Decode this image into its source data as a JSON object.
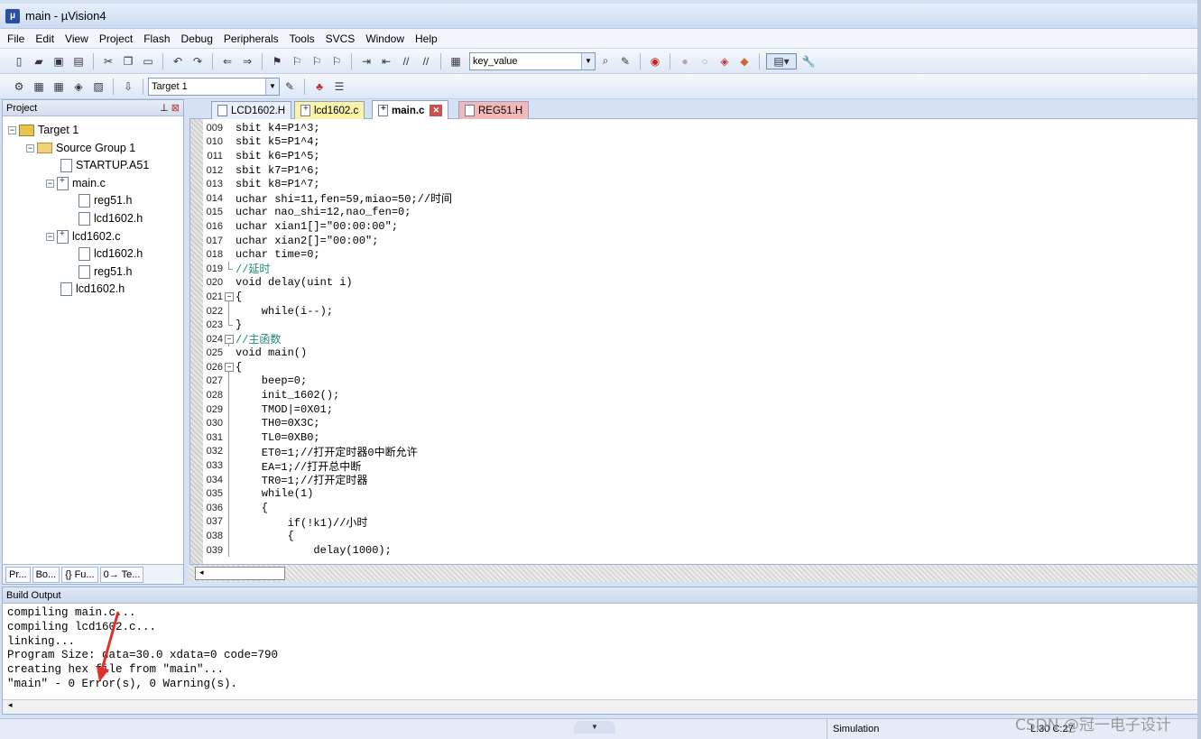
{
  "window": {
    "title": "main  - µVision4"
  },
  "menu": [
    "File",
    "Edit",
    "View",
    "Project",
    "Flash",
    "Debug",
    "Peripherals",
    "Tools",
    "SVCS",
    "Window",
    "Help"
  ],
  "toolbar": {
    "find_combo": "key_value",
    "target_combo": "Target 1"
  },
  "project_panel": {
    "title": "Project",
    "tree": [
      {
        "label": "Target 1",
        "icon": "target-icon"
      },
      {
        "label": "Source Group 1",
        "icon": "folder-icon"
      },
      {
        "label": "STARTUP.A51",
        "icon": "file-icon"
      },
      {
        "label": "main.c",
        "icon": "c-file-icon"
      },
      {
        "label": "reg51.h",
        "icon": "header-file-icon"
      },
      {
        "label": "lcd1602.h",
        "icon": "header-file-icon"
      },
      {
        "label": "lcd1602.c",
        "icon": "c-file-icon"
      },
      {
        "label": "lcd1602.h",
        "icon": "header-file-icon"
      },
      {
        "label": "reg51.h",
        "icon": "header-file-icon"
      },
      {
        "label": "lcd1602.h",
        "icon": "header-file-icon"
      }
    ],
    "tabs": [
      "Pr...",
      "Bo...",
      "{} Fu...",
      "0→ Te..."
    ]
  },
  "editor": {
    "tabs": [
      {
        "label": "LCD1602.H",
        "style": "normal"
      },
      {
        "label": "lcd1602.c",
        "style": "yellow"
      },
      {
        "label": "main.c",
        "style": "active"
      },
      {
        "label": "REG51.H",
        "style": "red"
      }
    ],
    "lines": [
      {
        "n": "009",
        "t": "sbit k4=P1^3;"
      },
      {
        "n": "010",
        "t": "sbit k5=P1^4;"
      },
      {
        "n": "011",
        "t": "sbit k6=P1^5;"
      },
      {
        "n": "012",
        "t": "sbit k7=P1^6;"
      },
      {
        "n": "013",
        "t": "sbit k8=P1^7;"
      },
      {
        "n": "014",
        "t": "uchar shi=11,fen=59,miao=50;//时间"
      },
      {
        "n": "015",
        "t": "uchar nao_shi=12,nao_fen=0;"
      },
      {
        "n": "016",
        "t": "uchar xian1[]=\"00:00:00\";"
      },
      {
        "n": "017",
        "t": "uchar xian2[]=\"00:00\";"
      },
      {
        "n": "018",
        "t": "uchar time=0;"
      },
      {
        "n": "019",
        "t": "//延时"
      },
      {
        "n": "020",
        "t": "void delay(uint i)"
      },
      {
        "n": "021",
        "t": "{"
      },
      {
        "n": "022",
        "t": "    while(i--);"
      },
      {
        "n": "023",
        "t": "}"
      },
      {
        "n": "024",
        "t": "//主函数"
      },
      {
        "n": "025",
        "t": "void main()"
      },
      {
        "n": "026",
        "t": "{"
      },
      {
        "n": "027",
        "t": "    beep=0;"
      },
      {
        "n": "028",
        "t": "    init_1602();"
      },
      {
        "n": "029",
        "t": "    TMOD|=0X01;"
      },
      {
        "n": "030",
        "t": "    TH0=0X3C;"
      },
      {
        "n": "031",
        "t": "    TL0=0XB0;"
      },
      {
        "n": "032",
        "t": "    ET0=1;//打开定时器0中断允许"
      },
      {
        "n": "033",
        "t": "    EA=1;//打开总中断"
      },
      {
        "n": "034",
        "t": "    TR0=1;//打开定时器"
      },
      {
        "n": "035",
        "t": "    while(1)"
      },
      {
        "n": "036",
        "t": "    {"
      },
      {
        "n": "037",
        "t": "        if(!k1)//小时"
      },
      {
        "n": "038",
        "t": "        {"
      },
      {
        "n": "039",
        "t": "            delay(1000);"
      }
    ]
  },
  "build_output": {
    "title": "Build Output",
    "lines": [
      "compiling main.c...",
      "compiling lcd1602.c...",
      "linking...",
      "Program Size: data=30.0 xdata=0 code=790",
      "creating hex file from \"main\"...",
      "\"main\" - 0 Error(s), 0 Warning(s)."
    ]
  },
  "status": {
    "mode": "Simulation",
    "position": "L:30 C:27",
    "watermark": "CSDN @冠一电子设计"
  },
  "colors": {
    "comment": "#1f8a78",
    "annotation_arrow": "#e0302a"
  }
}
